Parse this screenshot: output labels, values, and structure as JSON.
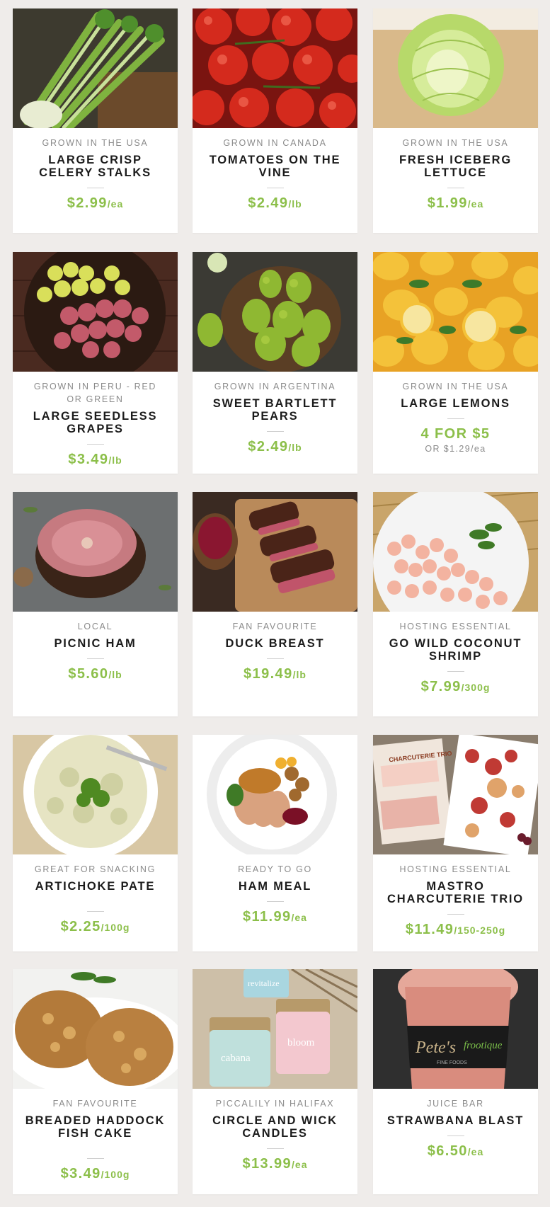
{
  "products": [
    {
      "origin": "GROWN IN THE USA",
      "name": "LARGE CRISP CELERY STALKS",
      "price": "$2.99",
      "unit": "/ea",
      "subprice": ""
    },
    {
      "origin": "GROWN IN CANADA",
      "name": "TOMATOES ON THE VINE",
      "price": "$2.49",
      "unit": "/lb",
      "subprice": ""
    },
    {
      "origin": "GROWN IN THE USA",
      "name": "FRESH ICEBERG LETTUCE",
      "price": "$1.99",
      "unit": "/ea",
      "subprice": ""
    },
    {
      "origin": "GROWN IN PERU - RED OR GREEN",
      "name": "LARGE SEEDLESS GRAPES",
      "price": "$3.49",
      "unit": "/lb",
      "subprice": ""
    },
    {
      "origin": "GROWN IN ARGENTINA",
      "name": "SWEET BARTLETT PEARS",
      "price": "$2.49",
      "unit": "/lb",
      "subprice": ""
    },
    {
      "origin": "GROWN IN THE USA",
      "name": "LARGE LEMONS",
      "price": "4 FOR $5",
      "unit": "",
      "subprice": "OR $1.29/ea"
    },
    {
      "origin": "LOCAL",
      "name": "PICNIC HAM",
      "price": "$5.60",
      "unit": "/lb",
      "subprice": ""
    },
    {
      "origin": "FAN FAVOURITE",
      "name": "DUCK BREAST",
      "price": "$19.49",
      "unit": "/lb",
      "subprice": ""
    },
    {
      "origin": "HOSTING ESSENTIAL",
      "name": "GO WILD COCONUT SHRIMP",
      "price": "$7.99",
      "unit": "/300g",
      "subprice": ""
    },
    {
      "origin": "GREAT FOR SNACKING",
      "name": "ARTICHOKE PATE",
      "price": "$2.25",
      "unit": "/100g",
      "subprice": ""
    },
    {
      "origin": "READY TO GO",
      "name": "HAM MEAL",
      "price": "$11.99",
      "unit": "/ea",
      "subprice": ""
    },
    {
      "origin": "HOSTING ESSENTIAL",
      "name": "MASTRO CHARCUTERIE TRIO",
      "price": "$11.49",
      "unit": "/150-250g",
      "subprice": ""
    },
    {
      "origin": "FAN FAVOURITE",
      "name": "BREADED HADDOCK FISH CAKE",
      "price": "$3.49",
      "unit": "/100g",
      "subprice": ""
    },
    {
      "origin": "PICCALILY IN HALIFAX",
      "name": "CIRCLE AND WICK CANDLES",
      "price": "$13.99",
      "unit": "/ea",
      "subprice": ""
    },
    {
      "origin": "JUICE BAR",
      "name": "STRAWBANA BLAST",
      "price": "$6.50",
      "unit": "/ea",
      "subprice": ""
    }
  ],
  "image_text": {
    "candle_1": "revitalize",
    "candle_2": "bloom",
    "candle_3": "cabana",
    "charcuterie_pack": "CHARCUTERIE TRIO",
    "cup_brand": "Pete's",
    "cup_brand_2": "frootique",
    "cup_sub": "FINE FOODS"
  },
  "colors": {
    "page_bg": "#efecea",
    "card_bg": "#ffffff",
    "price": "#8cbf4a",
    "origin": "#8b8b8b",
    "name": "#1b1b1b"
  }
}
